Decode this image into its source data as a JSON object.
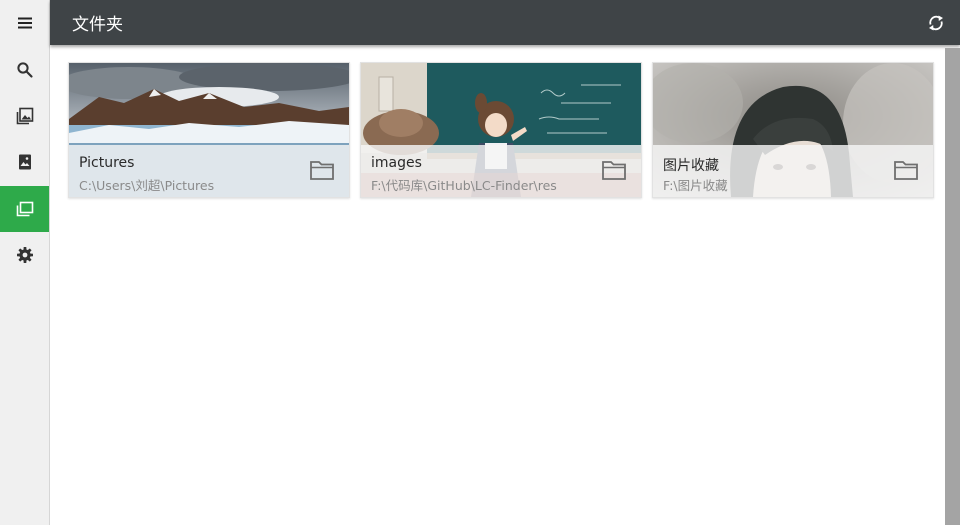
{
  "header": {
    "title": "文件夹",
    "refresh_icon": "refresh-icon",
    "background": "#3f4447"
  },
  "sidebar": {
    "accent": "#2eaa4a",
    "items": [
      {
        "icon": "menu-icon",
        "active": false
      },
      {
        "icon": "search-icon",
        "active": false
      },
      {
        "icon": "images-icon",
        "active": false
      },
      {
        "icon": "image-icon",
        "active": false
      },
      {
        "icon": "folders-icon",
        "active": true
      },
      {
        "icon": "gear-icon",
        "active": false
      }
    ]
  },
  "folders": [
    {
      "name": "Pictures",
      "path": "C:\\Users\\刘超\\Pictures",
      "icon": "folder-icon"
    },
    {
      "name": "images",
      "path": "F:\\代码库\\GitHub\\LC-Finder\\res",
      "icon": "folder-icon"
    },
    {
      "name": "图片收藏",
      "path": "F:\\图片收藏",
      "icon": "folder-icon"
    }
  ]
}
